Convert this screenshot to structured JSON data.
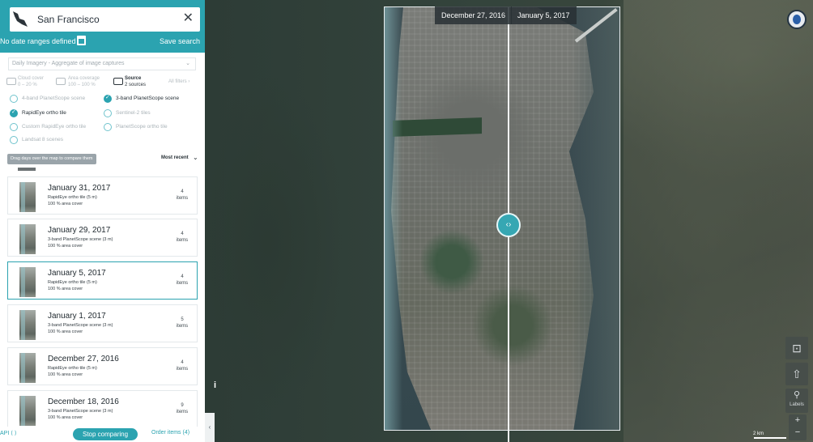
{
  "search": {
    "value": "San Francisco",
    "close_icon": "✕"
  },
  "dates": {
    "text": "No date ranges defined",
    "save_label": "Save search"
  },
  "imagery": {
    "label": "Daily Imagery - Aggregate of image captures",
    "chev": "⌄"
  },
  "filters": {
    "cloud_label": "Cloud cover",
    "cloud_range": "0 – 20 %",
    "area_label": "Area coverage",
    "area_range": "100 – 100 %",
    "source_label": "Source",
    "source_count": "2 sources",
    "all_label": "All filters ›"
  },
  "options": [
    {
      "label": "4-band PlanetScope scene",
      "checked": false
    },
    {
      "label": "3-band PlanetScope scene",
      "checked": true
    },
    {
      "label": "RapidEye ortho tile",
      "checked": true
    },
    {
      "label": "Sentinel-2 tiles",
      "checked": false
    },
    {
      "label": "Custom RapidEye ortho tile",
      "checked": false
    },
    {
      "label": "PlanetScope ortho tile",
      "checked": false
    },
    {
      "label": "Landsat 8 scenes",
      "checked": false
    }
  ],
  "list": {
    "drag_tip": "Drag days over the map to compare them",
    "sort_label": "Most recent",
    "sort_chev": "⌄"
  },
  "cards": [
    {
      "date": "January 31, 2017",
      "tile": "RapidEye ortho tile (5 m)",
      "cover": "100 % area cover",
      "count": "4",
      "unit": "items"
    },
    {
      "date": "January 29, 2017",
      "tile": "3-band PlanetScope scene (3 m)",
      "cover": "100 % area cover",
      "count": "4",
      "unit": "items"
    },
    {
      "date": "January 5, 2017",
      "tile": "RapidEye ortho tile (5 m)",
      "cover": "100 % area cover",
      "count": "4",
      "unit": "items"
    },
    {
      "date": "January 1, 2017",
      "tile": "3-band PlanetScope scene (3 m)",
      "cover": "100 % area cover",
      "count": "5",
      "unit": "items"
    },
    {
      "date": "December 27, 2016",
      "tile": "RapidEye ortho tile (5 m)",
      "cover": "100 % area cover",
      "count": "4",
      "unit": "items"
    },
    {
      "date": "December 18, 2016",
      "tile": "3-band PlanetScope scene (3 m)",
      "cover": "100 % area cover",
      "count": "9",
      "unit": "items"
    }
  ],
  "footer": {
    "api": "API ⟨ ⟩",
    "stop": "Stop comparing",
    "order": "Order items (4)"
  },
  "map": {
    "left_date": "December 27, 2016",
    "right_date": "January 5, 2017",
    "handle_glyph": "‹›",
    "info_glyph": "i",
    "scale": "2 km",
    "labels_text": "Labels",
    "zoom_in": "+",
    "zoom_out": "−",
    "tool_share": "⊡",
    "tool_upload": "⇧",
    "tool_pin": "⚲",
    "collapse": "‹"
  },
  "colors": {
    "accent": "#2ba3b0",
    "panel": "#ffffff",
    "text": "#222b31"
  },
  "icons": [
    "globe-icon",
    "share-icon",
    "upload-icon",
    "pin-icon",
    "calendar-icon",
    "cloud-icon",
    "area-icon",
    "source-icon",
    "close-icon",
    "chevron-down-icon"
  ]
}
